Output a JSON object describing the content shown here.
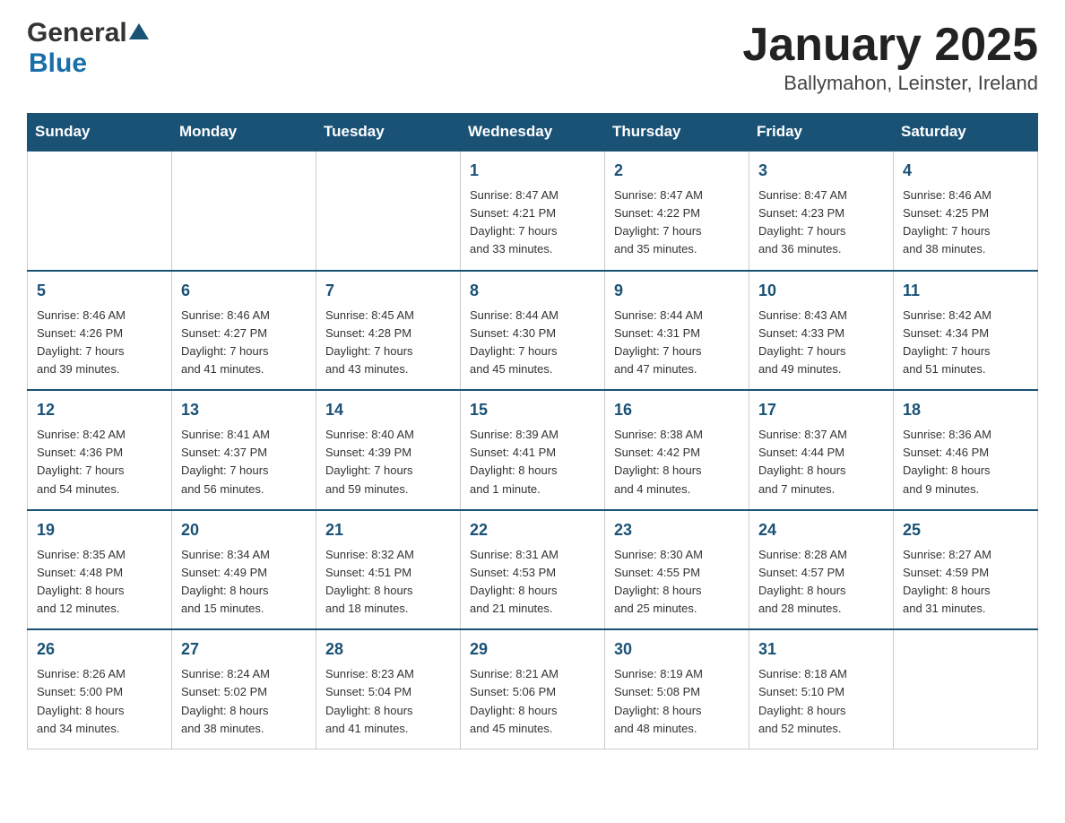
{
  "header": {
    "logo_general": "General",
    "logo_blue": "Blue",
    "title": "January 2025",
    "subtitle": "Ballymahon, Leinster, Ireland"
  },
  "calendar": {
    "days_of_week": [
      "Sunday",
      "Monday",
      "Tuesday",
      "Wednesday",
      "Thursday",
      "Friday",
      "Saturday"
    ],
    "weeks": [
      {
        "cells": [
          {
            "day": "",
            "info": ""
          },
          {
            "day": "",
            "info": ""
          },
          {
            "day": "",
            "info": ""
          },
          {
            "day": "1",
            "info": "Sunrise: 8:47 AM\nSunset: 4:21 PM\nDaylight: 7 hours\nand 33 minutes."
          },
          {
            "day": "2",
            "info": "Sunrise: 8:47 AM\nSunset: 4:22 PM\nDaylight: 7 hours\nand 35 minutes."
          },
          {
            "day": "3",
            "info": "Sunrise: 8:47 AM\nSunset: 4:23 PM\nDaylight: 7 hours\nand 36 minutes."
          },
          {
            "day": "4",
            "info": "Sunrise: 8:46 AM\nSunset: 4:25 PM\nDaylight: 7 hours\nand 38 minutes."
          }
        ]
      },
      {
        "cells": [
          {
            "day": "5",
            "info": "Sunrise: 8:46 AM\nSunset: 4:26 PM\nDaylight: 7 hours\nand 39 minutes."
          },
          {
            "day": "6",
            "info": "Sunrise: 8:46 AM\nSunset: 4:27 PM\nDaylight: 7 hours\nand 41 minutes."
          },
          {
            "day": "7",
            "info": "Sunrise: 8:45 AM\nSunset: 4:28 PM\nDaylight: 7 hours\nand 43 minutes."
          },
          {
            "day": "8",
            "info": "Sunrise: 8:44 AM\nSunset: 4:30 PM\nDaylight: 7 hours\nand 45 minutes."
          },
          {
            "day": "9",
            "info": "Sunrise: 8:44 AM\nSunset: 4:31 PM\nDaylight: 7 hours\nand 47 minutes."
          },
          {
            "day": "10",
            "info": "Sunrise: 8:43 AM\nSunset: 4:33 PM\nDaylight: 7 hours\nand 49 minutes."
          },
          {
            "day": "11",
            "info": "Sunrise: 8:42 AM\nSunset: 4:34 PM\nDaylight: 7 hours\nand 51 minutes."
          }
        ]
      },
      {
        "cells": [
          {
            "day": "12",
            "info": "Sunrise: 8:42 AM\nSunset: 4:36 PM\nDaylight: 7 hours\nand 54 minutes."
          },
          {
            "day": "13",
            "info": "Sunrise: 8:41 AM\nSunset: 4:37 PM\nDaylight: 7 hours\nand 56 minutes."
          },
          {
            "day": "14",
            "info": "Sunrise: 8:40 AM\nSunset: 4:39 PM\nDaylight: 7 hours\nand 59 minutes."
          },
          {
            "day": "15",
            "info": "Sunrise: 8:39 AM\nSunset: 4:41 PM\nDaylight: 8 hours\nand 1 minute."
          },
          {
            "day": "16",
            "info": "Sunrise: 8:38 AM\nSunset: 4:42 PM\nDaylight: 8 hours\nand 4 minutes."
          },
          {
            "day": "17",
            "info": "Sunrise: 8:37 AM\nSunset: 4:44 PM\nDaylight: 8 hours\nand 7 minutes."
          },
          {
            "day": "18",
            "info": "Sunrise: 8:36 AM\nSunset: 4:46 PM\nDaylight: 8 hours\nand 9 minutes."
          }
        ]
      },
      {
        "cells": [
          {
            "day": "19",
            "info": "Sunrise: 8:35 AM\nSunset: 4:48 PM\nDaylight: 8 hours\nand 12 minutes."
          },
          {
            "day": "20",
            "info": "Sunrise: 8:34 AM\nSunset: 4:49 PM\nDaylight: 8 hours\nand 15 minutes."
          },
          {
            "day": "21",
            "info": "Sunrise: 8:32 AM\nSunset: 4:51 PM\nDaylight: 8 hours\nand 18 minutes."
          },
          {
            "day": "22",
            "info": "Sunrise: 8:31 AM\nSunset: 4:53 PM\nDaylight: 8 hours\nand 21 minutes."
          },
          {
            "day": "23",
            "info": "Sunrise: 8:30 AM\nSunset: 4:55 PM\nDaylight: 8 hours\nand 25 minutes."
          },
          {
            "day": "24",
            "info": "Sunrise: 8:28 AM\nSunset: 4:57 PM\nDaylight: 8 hours\nand 28 minutes."
          },
          {
            "day": "25",
            "info": "Sunrise: 8:27 AM\nSunset: 4:59 PM\nDaylight: 8 hours\nand 31 minutes."
          }
        ]
      },
      {
        "cells": [
          {
            "day": "26",
            "info": "Sunrise: 8:26 AM\nSunset: 5:00 PM\nDaylight: 8 hours\nand 34 minutes."
          },
          {
            "day": "27",
            "info": "Sunrise: 8:24 AM\nSunset: 5:02 PM\nDaylight: 8 hours\nand 38 minutes."
          },
          {
            "day": "28",
            "info": "Sunrise: 8:23 AM\nSunset: 5:04 PM\nDaylight: 8 hours\nand 41 minutes."
          },
          {
            "day": "29",
            "info": "Sunrise: 8:21 AM\nSunset: 5:06 PM\nDaylight: 8 hours\nand 45 minutes."
          },
          {
            "day": "30",
            "info": "Sunrise: 8:19 AM\nSunset: 5:08 PM\nDaylight: 8 hours\nand 48 minutes."
          },
          {
            "day": "31",
            "info": "Sunrise: 8:18 AM\nSunset: 5:10 PM\nDaylight: 8 hours\nand 52 minutes."
          },
          {
            "day": "",
            "info": ""
          }
        ]
      }
    ]
  }
}
